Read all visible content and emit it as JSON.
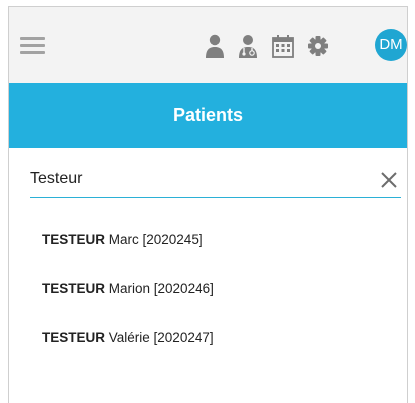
{
  "header": {
    "menu_icon": "hamburger-menu-icon",
    "icons": [
      "person-icon",
      "doctor-icon",
      "calendar-icon",
      "gear-icon"
    ],
    "avatar_initials": "DM",
    "accent_color": "#23b0de"
  },
  "title": "Patients",
  "search": {
    "value": "Testeur",
    "clear_icon": "close-icon"
  },
  "results": [
    {
      "lastname": "TESTEUR",
      "rest": " Marc [2020245]"
    },
    {
      "lastname": "TESTEUR",
      "rest": " Marion [2020246]"
    },
    {
      "lastname": "TESTEUR",
      "rest": " Valérie [2020247]"
    }
  ]
}
